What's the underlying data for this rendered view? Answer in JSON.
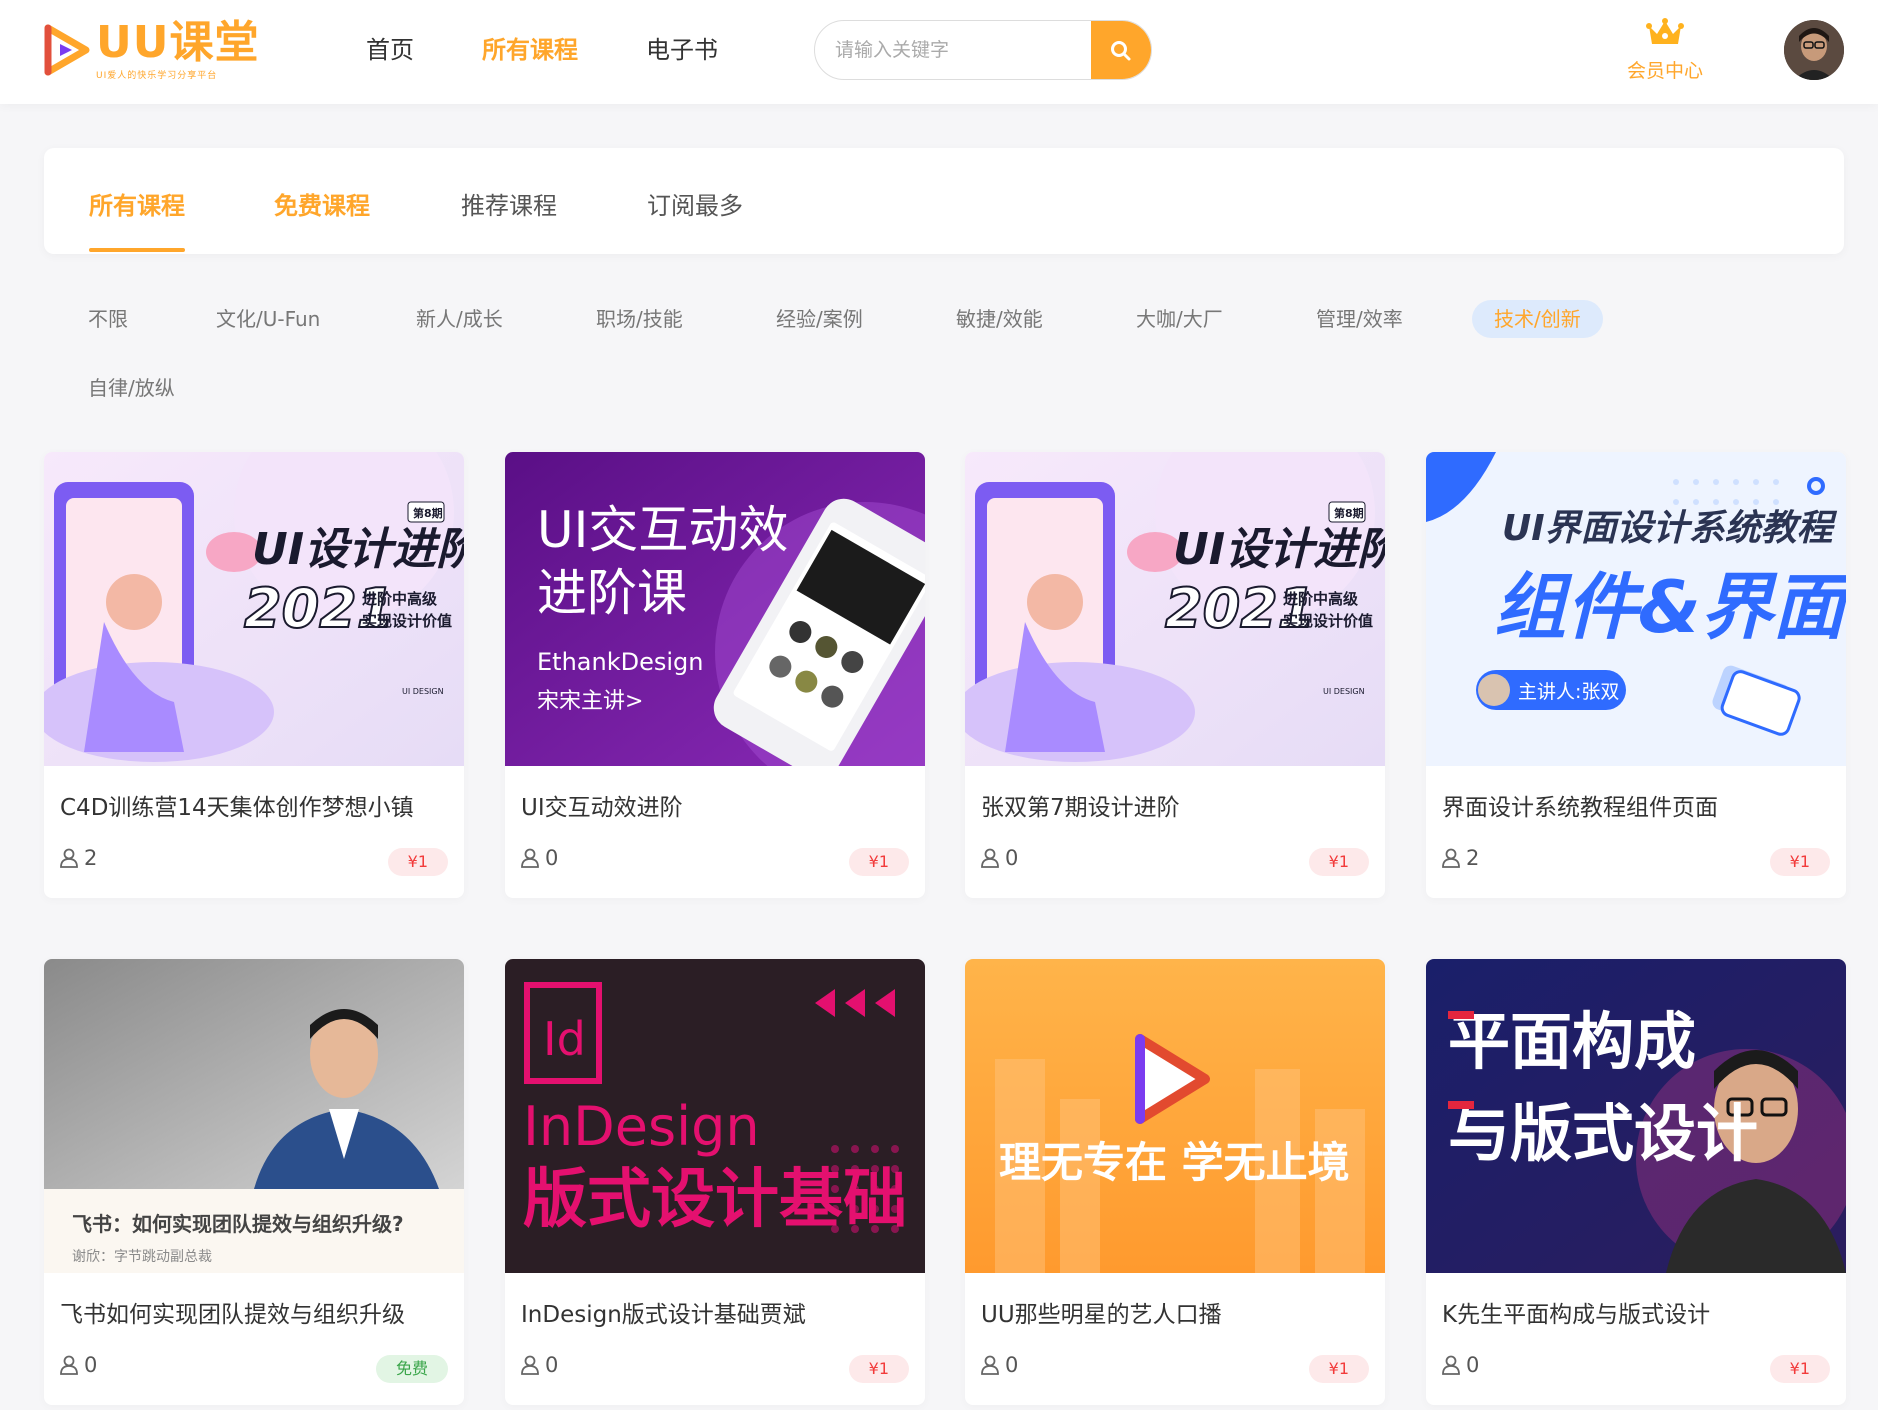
{
  "brand": {
    "title": "UU课堂",
    "subtitle": "UI爱人的快乐学习分享平台",
    "accent": "#ffa62b"
  },
  "nav": [
    {
      "label": "首页",
      "active": false
    },
    {
      "label": "所有课程",
      "active": true
    },
    {
      "label": "电子书",
      "active": false
    }
  ],
  "search": {
    "placeholder": "请输入关键字",
    "icon": "search-icon"
  },
  "member": {
    "label": "会员中心",
    "icon": "crown-icon"
  },
  "tabs": [
    {
      "label": "所有课程"
    },
    {
      "label": "免费课程"
    },
    {
      "label": "推荐课程"
    },
    {
      "label": "订阅最多"
    }
  ],
  "filters": [
    {
      "label": "不限"
    },
    {
      "label": "文化/U-Fun"
    },
    {
      "label": "新人/成长"
    },
    {
      "label": "职场/技能"
    },
    {
      "label": "经验/案例"
    },
    {
      "label": "敏捷/效能"
    },
    {
      "label": "大咖/大厂"
    },
    {
      "label": "管理/效率"
    },
    {
      "label": "技术/创新"
    },
    {
      "label": "自律/放纵"
    }
  ],
  "courses": [
    {
      "title": "C4D训练营14天集体创作梦想小镇",
      "count": "2",
      "price": "¥1",
      "thumb": {
        "lines": [
          "UI设计进阶班",
          "2021",
          "进阶中高级",
          "实现设计价值",
          "第8期",
          "UI DESIGN"
        ]
      }
    },
    {
      "title": "UI交互动效进阶",
      "count": "0",
      "price": "¥1",
      "thumb": {
        "lines": [
          "UI交互动效",
          "进阶课",
          "EthankDesign",
          "宋宋主讲>"
        ]
      }
    },
    {
      "title": "张双第7期设计进阶",
      "count": "0",
      "price": "¥1",
      "thumb": {
        "lines": [
          "UI设计进阶班",
          "2021",
          "进阶中高级",
          "实现设计价值",
          "第8期",
          "UI DESIGN"
        ]
      }
    },
    {
      "title": "界面设计系统教程组件页面",
      "count": "2",
      "price": "¥1",
      "thumb": {
        "lines": [
          "UI界面设计系统教程",
          "组件&界面",
          "主讲人:张双"
        ]
      }
    },
    {
      "title": "飞书如何实现团队提效与组织升级",
      "count": "0",
      "price": "免费",
      "thumb": {
        "lines": [
          "飞书：如何实现团队提效与组织升级?",
          "谢欣：字节跳动副总裁"
        ]
      }
    },
    {
      "title": "InDesign版式设计基础贾斌",
      "count": "0",
      "price": "¥1",
      "thumb": {
        "lines": [
          "Id",
          "InDesign",
          "版式设计基础"
        ]
      }
    },
    {
      "title": "UU那些明星的艺人口播",
      "count": "0",
      "price": "¥1",
      "thumb": {
        "lines": [
          "理无专在  学无止境"
        ]
      }
    },
    {
      "title": "K先生平面构成与版式设计",
      "count": "0",
      "price": "¥1",
      "thumb": {
        "lines": [
          "平面构成",
          "与版式设计"
        ]
      }
    }
  ]
}
